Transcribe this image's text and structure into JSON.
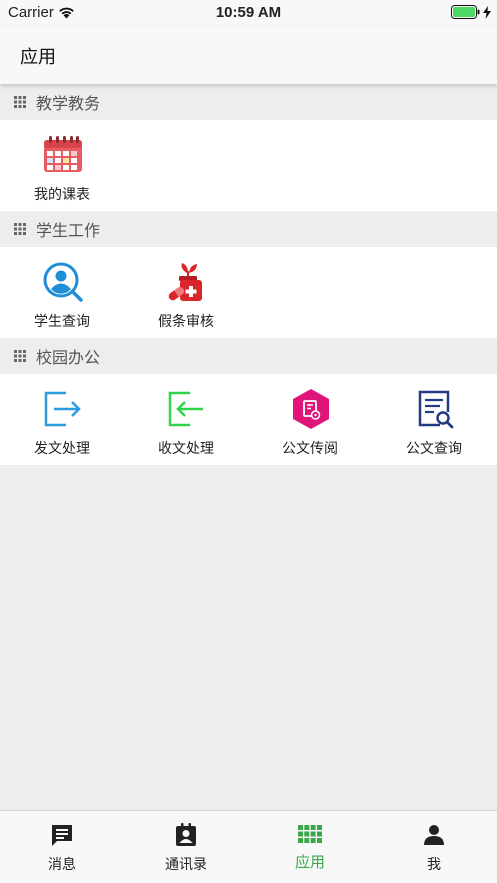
{
  "status": {
    "carrier": "Carrier",
    "time": "10:59 AM"
  },
  "nav": {
    "title": "应用"
  },
  "sections": [
    {
      "title": "教学教务",
      "items": [
        {
          "label": "我的课表",
          "icon": "calendar-icon"
        }
      ]
    },
    {
      "title": "学生工作",
      "items": [
        {
          "label": "学生查询",
          "icon": "person-search-icon"
        },
        {
          "label": "假条审核",
          "icon": "medicine-plant-icon"
        }
      ]
    },
    {
      "title": "校园办公",
      "items": [
        {
          "label": "发文处理",
          "icon": "document-send-icon"
        },
        {
          "label": "收文处理",
          "icon": "document-receive-icon"
        },
        {
          "label": "公文传阅",
          "icon": "document-circulate-icon"
        },
        {
          "label": "公文查询",
          "icon": "document-search-icon"
        }
      ]
    }
  ],
  "tabs": [
    {
      "label": "消息",
      "icon": "message-icon"
    },
    {
      "label": "通讯录",
      "icon": "contacts-icon"
    },
    {
      "label": "应用",
      "icon": "apps-grid-icon",
      "active": true
    },
    {
      "label": "我",
      "icon": "person-icon"
    }
  ],
  "colors": {
    "active_tab": "#3aa84a",
    "background": "#ededed"
  }
}
